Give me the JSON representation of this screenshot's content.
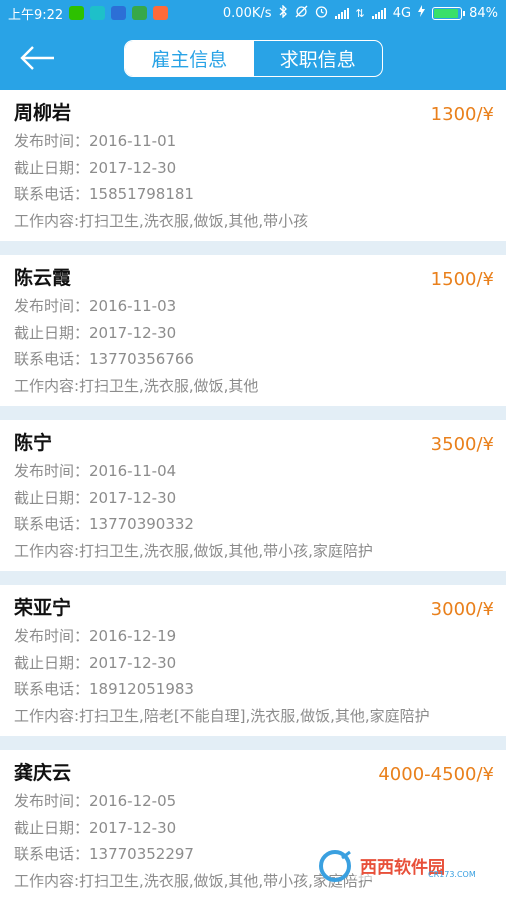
{
  "status_bar": {
    "time": "上午9:22",
    "network_speed": "0.00K/s",
    "network_type": "4G",
    "battery_percent": "84%",
    "battery_level": 0.84,
    "icons": [
      "wechat-icon",
      "app-icon",
      "shield-icon",
      "gallery-icon",
      "notes-icon",
      "bluetooth-icon",
      "mute-icon",
      "alarm-icon",
      "signal-icon",
      "charging-icon"
    ]
  },
  "header": {
    "back_icon": "arrow-left-icon",
    "tabs": [
      {
        "label": "雇主信息",
        "active": true
      },
      {
        "label": "求职信息",
        "active": false
      }
    ],
    "accent_color": "#29a3e6"
  },
  "listings": [
    {
      "name": "周柳岩",
      "salary": "1300/¥",
      "publish": "发布时间：2016-11-01",
      "deadline": "截止日期：2017-12-30",
      "phone": "联系电话：15851798181",
      "work": "工作内容:打扫卫生,洗衣服,做饭,其他,带小孩"
    },
    {
      "name": "陈云霞",
      "salary": "1500/¥",
      "publish": "发布时间：2016-11-03",
      "deadline": "截止日期：2017-12-30",
      "phone": "联系电话：13770356766",
      "work": "工作内容:打扫卫生,洗衣服,做饭,其他"
    },
    {
      "name": "陈宁",
      "salary": "3500/¥",
      "publish": "发布时间：2016-11-04",
      "deadline": "截止日期：2017-12-30",
      "phone": "联系电话：13770390332",
      "work": "工作内容:打扫卫生,洗衣服,做饭,其他,带小孩,家庭陪护"
    },
    {
      "name": "荣亚宁",
      "salary": "3000/¥",
      "publish": "发布时间：2016-12-19",
      "deadline": "截止日期：2017-12-30",
      "phone": "联系电话：18912051983",
      "work": "工作内容:打扫卫生,陪老[不能自理],洗衣服,做饭,其他,家庭陪护"
    },
    {
      "name": "龚庆云",
      "salary": "4000-4500/¥",
      "publish": "发布时间：2016-12-05",
      "deadline": "截止日期：2017-12-30",
      "phone": "联系电话：13770352297",
      "work": "工作内容:打扫卫生,洗衣服,做饭,其他,带小孩,家庭陪护"
    }
  ],
  "watermark": {
    "text": "西西软件园",
    "subtext": "CR173.COM"
  }
}
